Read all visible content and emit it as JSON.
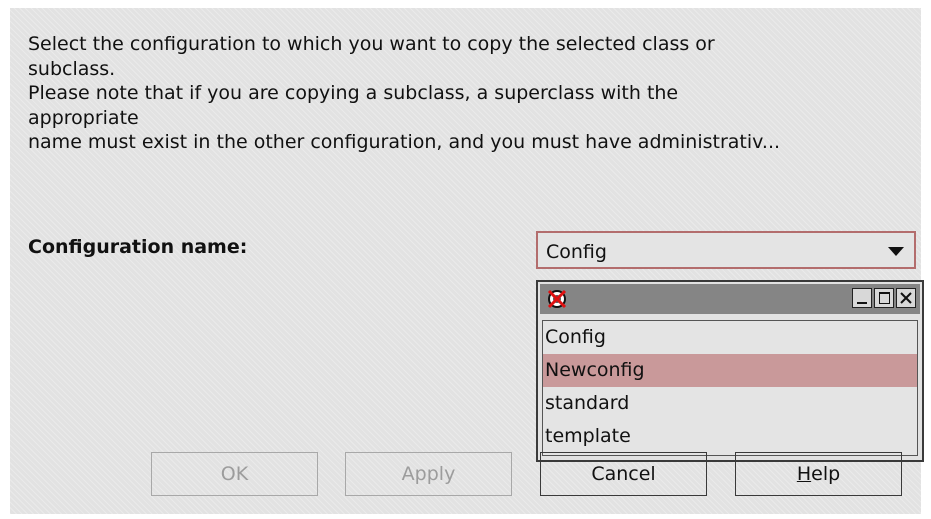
{
  "instructions": {
    "line1": "Select the configuration to which you want to copy the selected class or",
    "line2": "subclass.",
    "line3": "Please note that if you are copying a subclass, a superclass with the",
    "line4": "appropriate",
    "line5": "name must exist in the other configuration, and you must have administrativ..."
  },
  "config": {
    "label": "Configuration name:",
    "selected_value": "Config"
  },
  "popup": {
    "title_icon": "app-icon",
    "items": [
      {
        "label": "Config",
        "selected": false
      },
      {
        "label": "Newconfig",
        "selected": true
      },
      {
        "label": "standard",
        "selected": false
      },
      {
        "label": "template",
        "selected": false
      }
    ]
  },
  "buttons": {
    "ok": {
      "label": "OK",
      "enabled": false
    },
    "apply": {
      "label": "Apply",
      "enabled": false
    },
    "cancel": {
      "label": "Cancel",
      "enabled": true
    },
    "help": {
      "mnemonic": "H",
      "label_rest": "elp",
      "enabled": true
    }
  },
  "colors": {
    "dialog_background": "#e2e2e2",
    "combo_border": "#b36d6d",
    "selection_highlight": "#c9999a",
    "titlebar": "#858585"
  }
}
